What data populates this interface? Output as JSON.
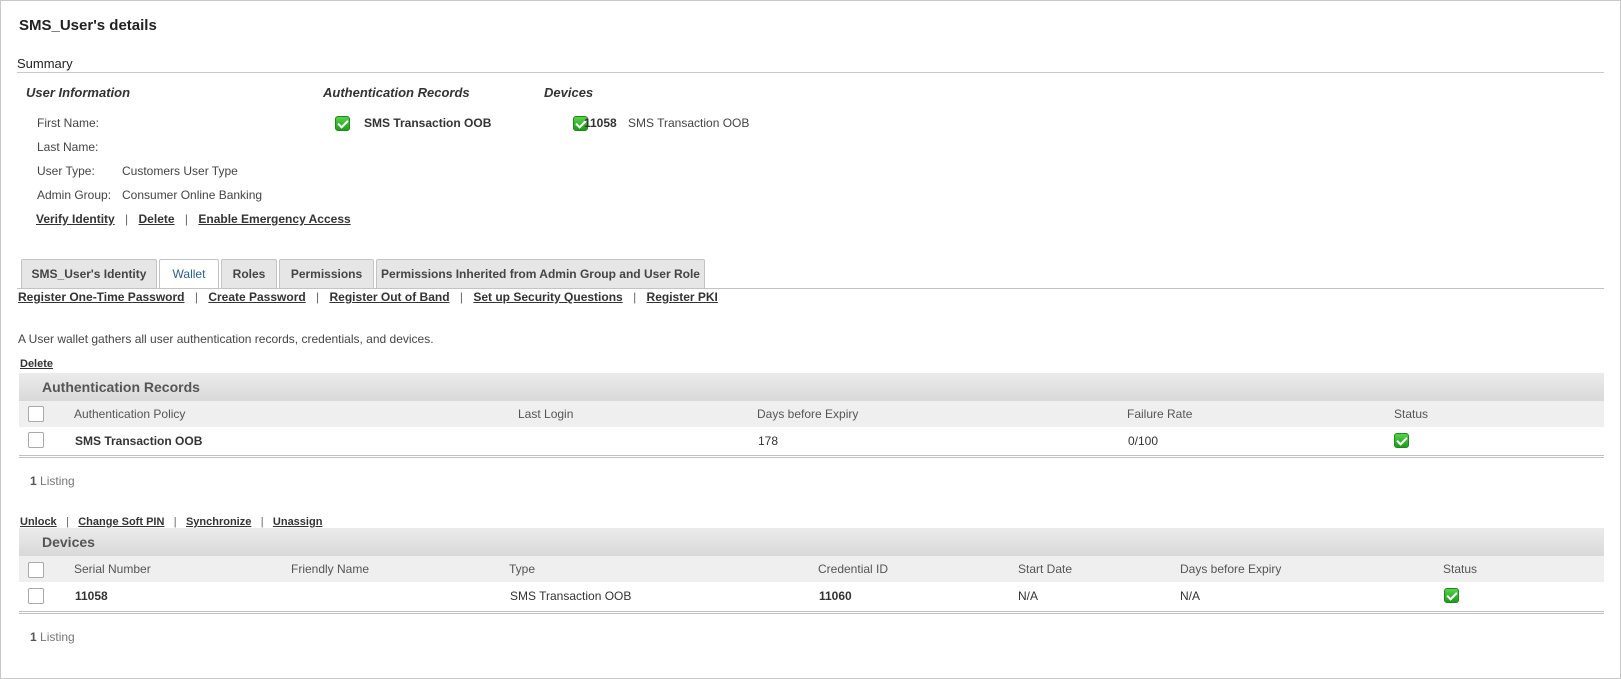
{
  "page": {
    "title": "SMS_User's details"
  },
  "summary": {
    "heading": "Summary",
    "user_info": {
      "heading": "User Information",
      "fields": [
        {
          "label": "First Name:",
          "value": ""
        },
        {
          "label": "Last Name:",
          "value": ""
        },
        {
          "label": "User Type:",
          "value": "Customers User Type"
        },
        {
          "label": "Admin Group:",
          "value": "Consumer Online Banking"
        }
      ],
      "actions": [
        "Verify Identity",
        "Delete",
        "Enable Emergency Access"
      ]
    },
    "auth_records": {
      "heading": "Authentication Records",
      "items": [
        {
          "name": "SMS Transaction OOB",
          "icon": "status-ok-icon"
        }
      ]
    },
    "devices": {
      "heading": "Devices",
      "items": [
        {
          "serial": "11058",
          "type": "SMS Transaction OOB",
          "icon": "status-ok-icon"
        }
      ]
    }
  },
  "tabs": [
    {
      "label": "SMS_User's Identity",
      "active": false
    },
    {
      "label": "Wallet",
      "active": true
    },
    {
      "label": "Roles",
      "active": false
    },
    {
      "label": "Permissions",
      "active": false
    },
    {
      "label": "Permissions Inherited from Admin Group and User Role",
      "active": false
    }
  ],
  "wallet": {
    "actions": [
      "Register One-Time Password",
      "Create Password",
      "Register Out of Band",
      "Set up Security Questions",
      "Register PKI"
    ],
    "description": "A User wallet gathers all user authentication records, credentials, and devices.",
    "auth_table": {
      "top_action": "Delete",
      "heading": "Authentication Records",
      "columns": [
        "Authentication Policy",
        "Last Login",
        "Days before Expiry",
        "Failure Rate",
        "Status"
      ],
      "rows": [
        {
          "policy": "SMS Transaction OOB",
          "last_login": "",
          "days_before_expiry": "178",
          "failure_rate": "0/100",
          "status": "ok"
        }
      ],
      "listing_count": "1",
      "listing_label": "Listing"
    },
    "device_table": {
      "top_actions": [
        "Unlock",
        "Change Soft PIN",
        "Synchronize",
        "Unassign"
      ],
      "heading": "Devices",
      "columns": [
        "Serial Number",
        "Friendly Name",
        "Type",
        "Credential ID",
        "Start Date",
        "Days before Expiry",
        "Status"
      ],
      "rows": [
        {
          "serial": "11058",
          "friendly_name": "",
          "type": "SMS Transaction OOB",
          "credential_id": "11060",
          "start_date": "N/A",
          "days_before_expiry": "N/A",
          "status": "ok"
        }
      ],
      "listing_count": "1",
      "listing_label": "Listing"
    }
  },
  "colors": {
    "status_ok": "#2fb52a",
    "tab_active_text": "#2c5f8a"
  }
}
